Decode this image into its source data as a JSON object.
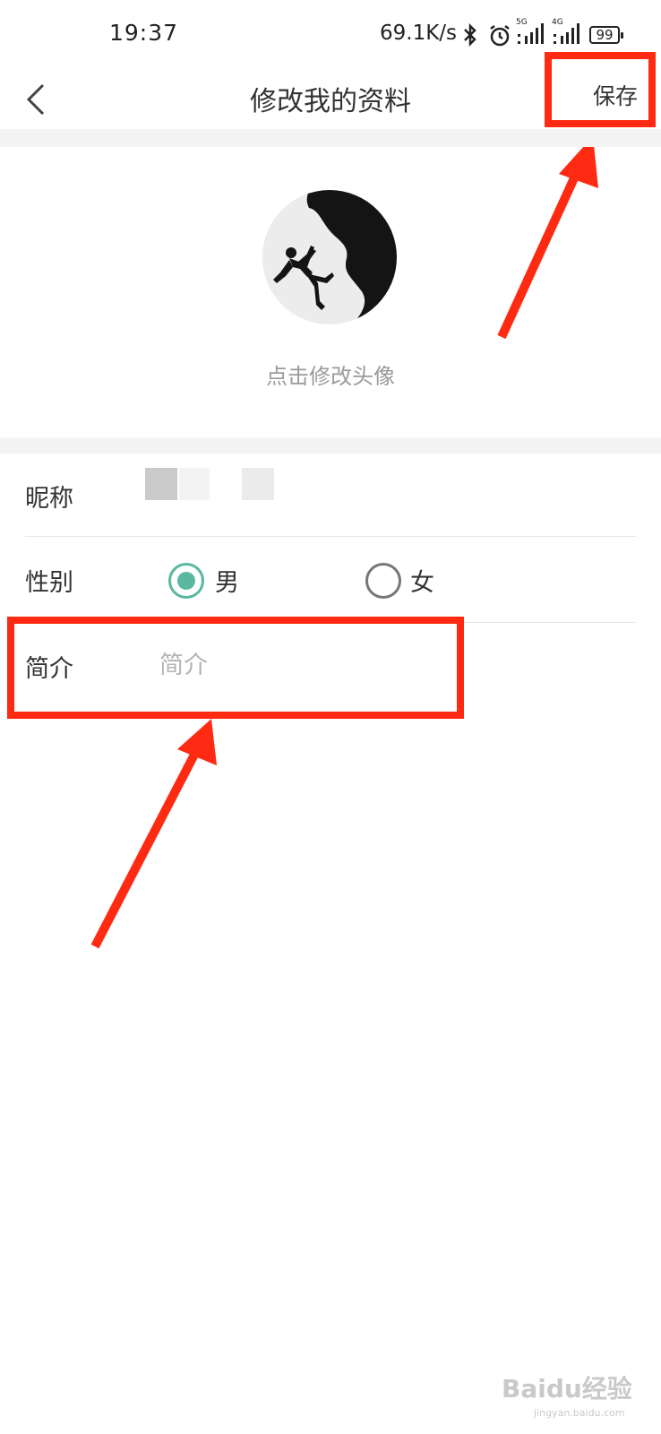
{
  "status_bar": {
    "time": "19:37",
    "network_speed": "69.1K/s",
    "signal1_tag": "5G",
    "signal2_tag": "4G",
    "battery": "99"
  },
  "header": {
    "title": "修改我的资料",
    "save_label": "保存"
  },
  "avatar": {
    "hint": "点击修改头像"
  },
  "form": {
    "nickname_label": "昵称",
    "gender_label": "性别",
    "gender_male": "男",
    "gender_female": "女",
    "gender_selected": "男",
    "intro_label": "简介",
    "intro_placeholder": "简介",
    "intro_value": ""
  },
  "watermark": {
    "brand": "Baidu经验",
    "url": "jingyan.baidu.com"
  },
  "colors": {
    "accent": "#5ab8a0",
    "highlight": "#ff2a12"
  }
}
